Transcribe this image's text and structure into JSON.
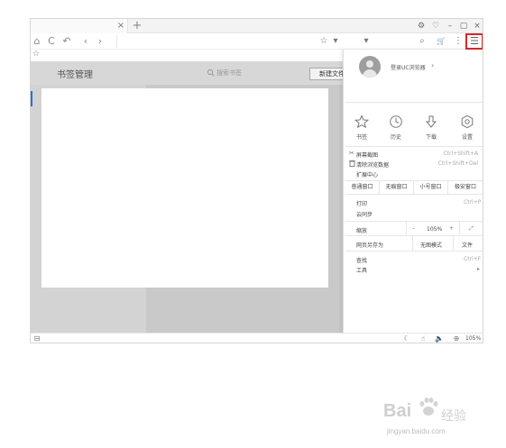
{
  "tab": {
    "close": "×",
    "new": "+"
  },
  "window_controls": {
    "icon1": "⚙",
    "icon2": "♡",
    "minimize": "–",
    "maximize": "▢",
    "close": "×"
  },
  "toolbar": {
    "home": "⌂",
    "refresh": "C",
    "undo": "↶",
    "back": "‹",
    "forward": "›",
    "star": "☆",
    "dropdown": "▾",
    "search": "⌕",
    "cart": "🛒",
    "more": "⋮",
    "menu": "☰"
  },
  "favorites": {
    "star": "☆"
  },
  "bookmark_manager": {
    "title": "书签管理",
    "search_placeholder": "搜索书签",
    "new_button": "新建文件夹"
  },
  "menu": {
    "login": "登录UC浏览器",
    "login_chevron": "›",
    "quick_actions": [
      {
        "label": "书签",
        "icon": "star-icon"
      },
      {
        "label": "历史",
        "icon": "clock-icon"
      },
      {
        "label": "下载",
        "icon": "download-icon"
      },
      {
        "label": "设置",
        "icon": "gear-icon"
      }
    ],
    "screenshot": {
      "label": "屏幕截图",
      "shortcut": "Ctrl+Shift+A"
    },
    "clear_data": {
      "label": "清除浏览数据",
      "shortcut": "Ctrl+Shift+Del"
    },
    "extensions": "扩展中心",
    "window_modes": [
      "普通窗口",
      "无痕窗口",
      "小号窗口",
      "极安窗口"
    ],
    "print": {
      "label": "打印",
      "shortcut": "Ctrl+P"
    },
    "cloud_sync": "云同步",
    "zoom": {
      "label": "缩放",
      "minus": "–",
      "value": "105%",
      "plus": "+",
      "fullscreen": "⤢"
    },
    "save_as": "网页另存为",
    "no_images": "无图模式",
    "text_mode": "文件",
    "find": {
      "label": "查找",
      "shortcut": "Ctrl+F"
    },
    "tools": "工具",
    "tools_arrow": "▸"
  },
  "statusbar": {
    "zoom": "105%"
  },
  "watermark": {
    "brand": "Bai",
    "suffix": "经验",
    "url": "jingyan.baidu.com"
  },
  "colors": {
    "highlight": "#d8282b",
    "accent": "#2a6fd6"
  }
}
